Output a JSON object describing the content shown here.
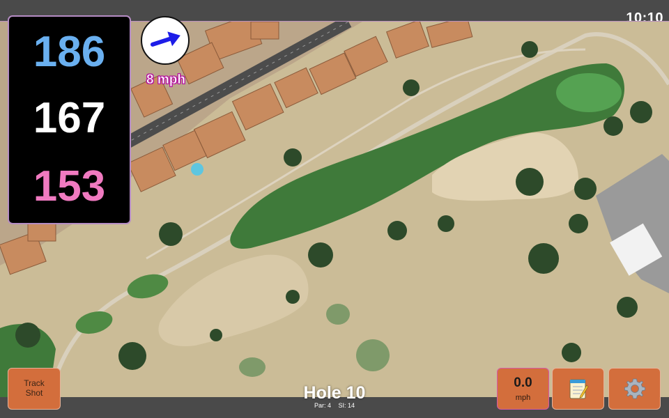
{
  "status": {
    "time": "10:10"
  },
  "distances": {
    "back": {
      "value": "186",
      "color": "#6ab0f0"
    },
    "middle": {
      "value": "167",
      "color": "#ffffff"
    },
    "front": {
      "value": "153",
      "color": "#f07ac0"
    }
  },
  "wind": {
    "speed_label": "8 mph",
    "direction_icon": "wind-arrow-icon",
    "arrow_color": "#1d1de8"
  },
  "hole": {
    "title": "Hole 10",
    "par_label": "Par: 4",
    "si_label": "SI: 14"
  },
  "controls": {
    "track_shot_line1": "Track",
    "track_shot_line2": "Shot",
    "wind_value": "0.0",
    "wind_unit": "mph",
    "notes_icon": "notepad-icon",
    "settings_icon": "gear-icon"
  },
  "colors": {
    "button_bg": "#d36e3c",
    "panel_border": "#b58cc4",
    "fairway": "#3f7a3a",
    "rough": "#c9b994"
  }
}
